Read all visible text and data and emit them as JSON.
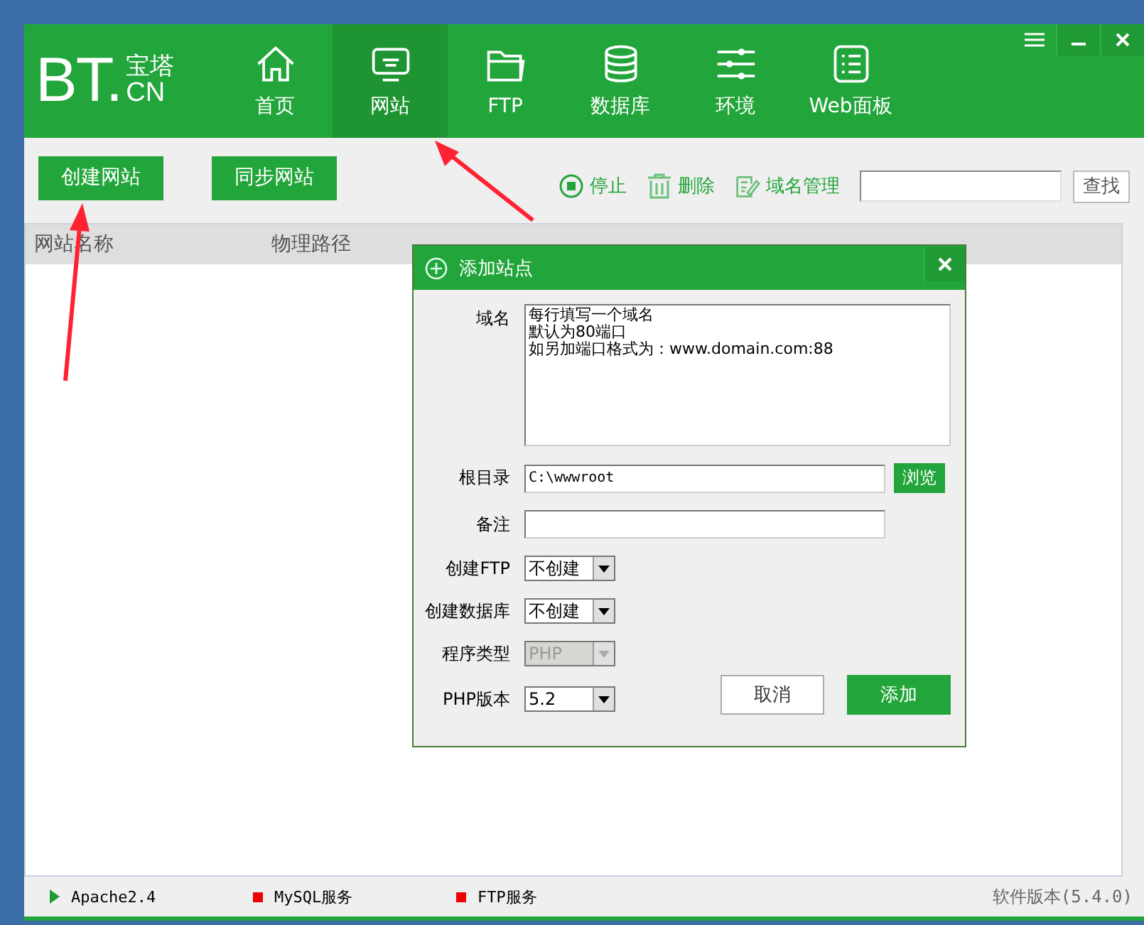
{
  "window": {
    "logo": {
      "main": "BT",
      "dot": ".",
      "top": "宝塔",
      "bottom": "CN"
    }
  },
  "nav": [
    {
      "label": "首页",
      "selected": false
    },
    {
      "label": "网站",
      "selected": true
    },
    {
      "label": "FTP",
      "selected": false
    },
    {
      "label": "数据库",
      "selected": false
    },
    {
      "label": "环境",
      "selected": false
    },
    {
      "label": "Web面板",
      "selected": false
    }
  ],
  "toolbar": {
    "buttons": [
      "创建网站",
      "同步网站"
    ],
    "actions": [
      {
        "label": "停止"
      },
      {
        "label": "删除"
      },
      {
        "label": "域名管理"
      }
    ],
    "search_button": "查找"
  },
  "table": {
    "columns": [
      "网站名称",
      "物理路径"
    ]
  },
  "dialog": {
    "title": "添加站点",
    "fields": [
      {
        "kind": "textarea",
        "label": "域名",
        "lines": [
          "每行填写一个域名",
          "默认为80端口",
          "如另加端口格式为：www.domain.com:88"
        ]
      },
      {
        "kind": "text",
        "label": "根目录",
        "value": "C:\\wwwroot",
        "button": "浏览"
      },
      {
        "kind": "text",
        "label": "备注"
      },
      {
        "kind": "select",
        "label": "创建FTP",
        "value": "不创建",
        "disabled": false
      },
      {
        "kind": "select",
        "label": "创建数据库",
        "value": "不创建",
        "disabled": false
      },
      {
        "kind": "select",
        "label": "程序类型",
        "value": "PHP",
        "disabled": true
      },
      {
        "kind": "select",
        "label": "PHP版本",
        "value": "5.2",
        "disabled": false
      }
    ],
    "buttons": [
      {
        "label": "取消",
        "primary": false
      },
      {
        "label": "添加",
        "primary": true
      }
    ]
  },
  "status_bar": {
    "services": [
      {
        "name": "Apache2.4",
        "running": true
      },
      {
        "name": "MySQL服务",
        "running": false
      },
      {
        "name": "FTP服务",
        "running": false
      }
    ],
    "version": "软件版本(5.4.0)"
  }
}
